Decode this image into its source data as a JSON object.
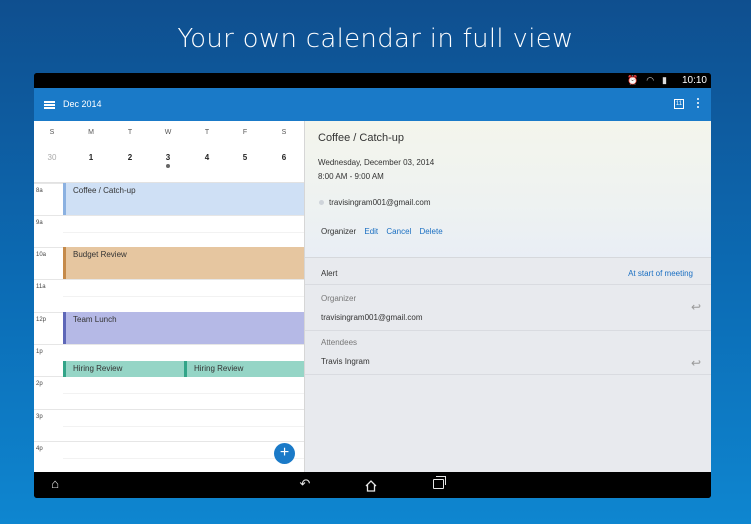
{
  "headline": "Your own calendar in full view",
  "status_bar": {
    "time": "10:10",
    "icons": [
      "alarm-icon",
      "wifi-icon",
      "battery-icon"
    ]
  },
  "app_bar": {
    "title": "Dec 2014",
    "today_badge": "11",
    "accent": "#1a7ac8"
  },
  "calendar": {
    "days": [
      {
        "dow": "S",
        "date": "30",
        "muted": true
      },
      {
        "dow": "M",
        "date": "1"
      },
      {
        "dow": "T",
        "date": "2"
      },
      {
        "dow": "W",
        "date": "3",
        "has_event": true
      },
      {
        "dow": "T",
        "date": "4"
      },
      {
        "dow": "F",
        "date": "5"
      },
      {
        "dow": "S",
        "date": "6"
      }
    ],
    "hours": [
      "8a",
      "9a",
      "10a",
      "11a",
      "12p",
      "1p",
      "2p",
      "3p",
      "4p"
    ],
    "events": [
      {
        "title": "Coffee / Catch-up",
        "color": "#cfe0f5"
      },
      {
        "title": "Budget Review",
        "color": "#e6c6a0"
      },
      {
        "title": "Team Lunch",
        "color": "#b5b9e6"
      },
      {
        "title": "Hiring Review",
        "color": "#95d5c6"
      },
      {
        "title": "Hiring Review",
        "color": "#95d5c6"
      }
    ],
    "fab_label": "+"
  },
  "detail": {
    "title": "Coffee / Catch-up",
    "date": "Wednesday, December 03, 2014",
    "time": "8:00 AM - 9:00 AM",
    "email": "travisingram001@gmail.com",
    "organizer_label": "Organizer",
    "actions": [
      "Edit",
      "Cancel",
      "Delete"
    ],
    "alert_label": "Alert",
    "alert_value": "At start of meeting",
    "organizer_section_label": "Organizer",
    "organizer_email": "travisingram001@gmail.com",
    "attendees_label": "Attendees",
    "attendee": "Travis Ingram"
  },
  "nav_bar": {
    "icons": [
      "collapse-icon",
      "back-icon",
      "home-icon",
      "recent-apps-icon"
    ]
  }
}
